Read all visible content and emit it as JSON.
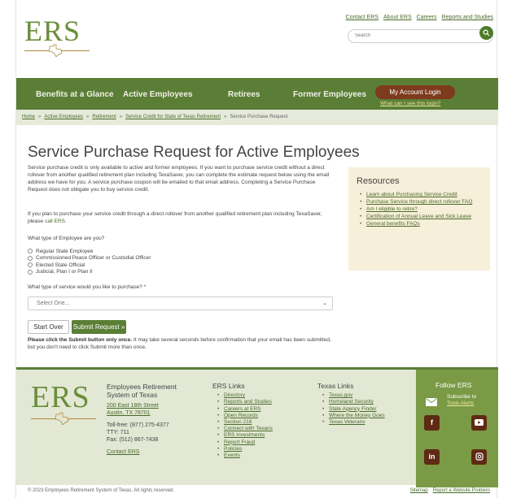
{
  "brand": {
    "logo": "ERS",
    "accent": "#5a7e35",
    "button_dark": "#7d3a1d"
  },
  "header": {
    "links": [
      "Contact ERS",
      "About ERS",
      "Careers",
      "Reports and Studies"
    ],
    "search_placeholder": "Search"
  },
  "nav": {
    "items": [
      "Benefits at a Glance",
      "Active Employees",
      "Retirees",
      "Former Employees"
    ],
    "login_label": "My Account Login",
    "login_help": "What can I see this login?"
  },
  "breadcrumbs": [
    "Home",
    "Active Employees",
    "Retirement",
    "Service Credit for State of Texas Retirement",
    "Service Purchase Request"
  ],
  "main": {
    "title": "Service Purchase Request for Active Employees",
    "intro": "Service purchase credit is only available to active and former employees. If you want to purchase service credit without a direct rollover from another qualified retirement plan including TexaSaver, you can complete the estimate request below using the email address we have for you. A service purchase coupon will be emailed to that email address. Completing a Service Purchase Request does not obligate you to buy service credit.",
    "intro2_text": "If you plan to purchase your service credit through a direct rollover from another qualified retirement plan including TexaSaver, please ",
    "intro2_link": "call ERS",
    "q1": "What type of Employee are you?",
    "options": [
      "Regular State Employee",
      "Commissioned Peace Officer or Custodial Officer",
      "Elected State Official",
      "Judicial, Plan I or Plan II"
    ],
    "q2": "What type of service would you like to purchase? *",
    "select_value": "Select One...",
    "start_over": "Start Over",
    "submit": "Submit Request »",
    "note_bold": "Please click the Submit button only once.",
    "note_rest": " It may take several seconds before confirmation that your email has been submitted, but you don't need to click Submit more than once."
  },
  "resources": {
    "title": "Resources",
    "items": [
      "Learn about Purchasing Service Credit",
      "Purchase Service through direct rollover FAQ",
      "Am I eligible to retire?",
      "Certification of Annual Leave and Sick Leave",
      "General benefits FAQs"
    ]
  },
  "footer": {
    "org": "Employees Retirement System of Texas",
    "address1": "200 East 18th Street",
    "address2": "Austin, TX 78701",
    "tollfree": "Toll-free: (877) 275-4377",
    "tty": "TTY: 711",
    "fax": "Fax: (512) 867-7438",
    "contact": "Contact ERS",
    "ers_links_title": "ERS Links",
    "ers_links": [
      "Directory",
      "Reports and Studies",
      "Careers at ERS",
      "Open Records",
      "Section 218",
      "Connect with Texans",
      "ERS Investments",
      "Report Fraud",
      "Policies",
      "Events"
    ],
    "texas_links_title": "Texas Links",
    "texas_links": [
      "Texas.gov",
      "Homeland Security",
      "State Agency Finder",
      "Where the Money Goes",
      "Texas Veterans"
    ],
    "follow_title": "Follow ERS",
    "subscribe1": "Subscribe to",
    "subscribe2": "Tools Alerts",
    "social": [
      "f",
      "yt",
      "in",
      "ig"
    ],
    "copyright": "© 2023 Employees Retirement System of Texas. All rights reserved.",
    "bottom_links": [
      "Sitemap",
      "Report a Website Problem"
    ]
  }
}
